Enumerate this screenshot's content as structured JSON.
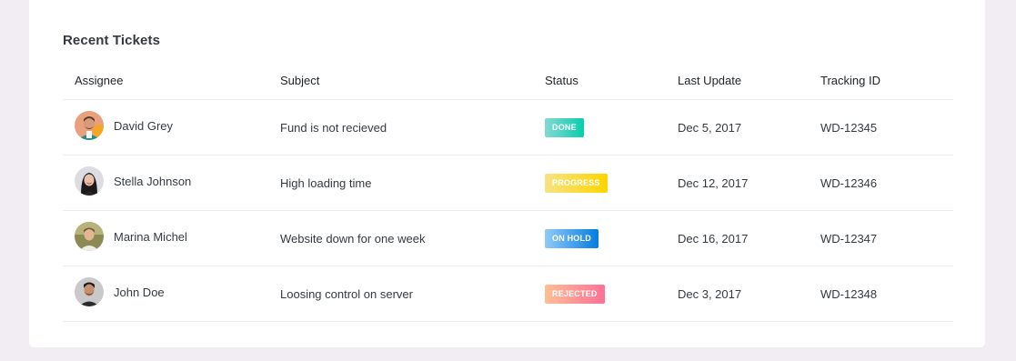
{
  "card": {
    "title": "Recent Tickets"
  },
  "table": {
    "headers": [
      "Assignee",
      "Subject",
      "Status",
      "Last Update",
      "Tracking ID"
    ],
    "rows": [
      {
        "name": "David Grey",
        "subject": "Fund is not recieved",
        "status": "DONE",
        "status_color": "#1bcfb4",
        "updated": "Dec 5, 2017",
        "tracking_id": "WD-12345",
        "avatar": "avatar-david-grey"
      },
      {
        "name": "Stella Johnson",
        "subject": "High loading time",
        "status": "PROGRESS",
        "status_color": "#fed713",
        "updated": "Dec 12, 2017",
        "tracking_id": "WD-12346",
        "avatar": "avatar-stella-johnson"
      },
      {
        "name": "Marina Michel",
        "subject": "Website down for one week",
        "status": "ON HOLD",
        "status_color": "#198ae3",
        "updated": "Dec 16, 2017",
        "tracking_id": "WD-12347",
        "avatar": "avatar-marina-michel"
      },
      {
        "name": "John Doe",
        "subject": "Loosing control on server",
        "status": "REJECTED",
        "status_color": "#fe7c96",
        "updated": "Dec 3, 2017",
        "tracking_id": "WD-12348",
        "avatar": "avatar-john-doe"
      }
    ]
  },
  "colors": {
    "page_bg": "#f2edf3",
    "card_bg": "#ffffff",
    "done": "#1bcfb4",
    "progress": "#fed713",
    "on_hold": "#198ae3",
    "rejected": "#fe7c96"
  }
}
